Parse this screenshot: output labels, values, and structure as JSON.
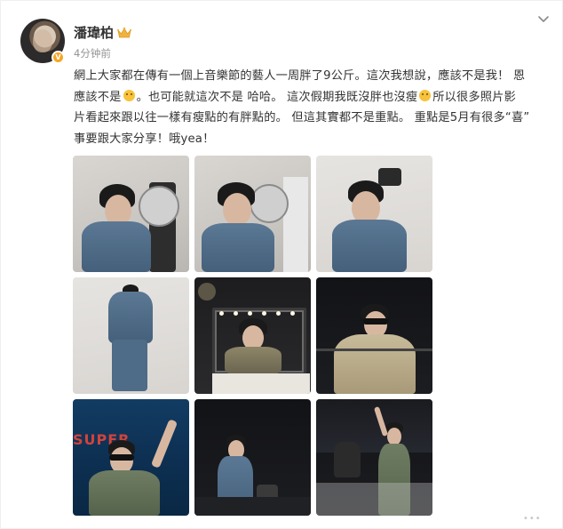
{
  "post": {
    "username": "潘瑋柏",
    "timestamp": "4分钟前",
    "text_lines": [
      "網上大家都在傳有一個上音樂節的藝人一周胖了9公斤。這次我想說，應該不是我！ 恩",
      "應該不是",
      "。也可能就這次不是 哈哈。 這次假期我既沒胖也沒瘦",
      "所以很多照片影",
      "片看起來跟以往一樣有瘦點的有胖點的。 但這其實都不是重點。 重點是5月有很多“喜”",
      "事要跟大家分享！哦yea！"
    ],
    "icons": {
      "crown": "crown-icon",
      "verified": "verified-badge-icon",
      "menu": "chevron-down-icon",
      "emoji_1": "laughing-sweat-emoji",
      "emoji_2": "grimace-emoji"
    },
    "colors": {
      "username": "#333333",
      "timestamp": "#939393",
      "verified": "#f5a623",
      "crown": "#f2b33d"
    }
  },
  "gallery": {
    "photos": [
      "photo-1",
      "photo-2",
      "photo-3",
      "photo-4",
      "photo-5",
      "photo-6",
      "photo-7",
      "photo-8",
      "photo-9"
    ]
  }
}
